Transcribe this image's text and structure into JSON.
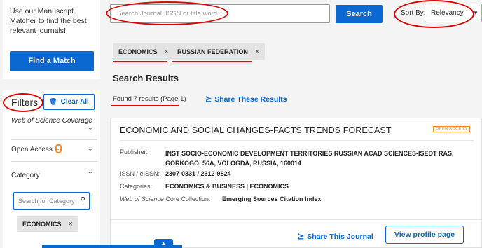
{
  "promo": {
    "text": "Use our Manuscript Matcher to find the best relevant journals!",
    "button": "Find a Match"
  },
  "filters": {
    "title": "Filters",
    "clear_label": "Clear All",
    "facets": [
      {
        "label": "Web of Science Coverage"
      },
      {
        "label": "Open Access"
      },
      {
        "label": "Category"
      }
    ],
    "category_search_placeholder": "Search for Category",
    "selected_chip": "ECONOMICS"
  },
  "search": {
    "placeholder": "Search Journal, ISSN or title word...",
    "button": "Search"
  },
  "sort": {
    "label": "Sort By:",
    "value": "Relevancy"
  },
  "active_filters": [
    "ECONOMICS",
    "RUSSIAN FEDERATION"
  ],
  "results": {
    "heading": "Search Results",
    "found_text": "Found 7 results (Page 1)",
    "share_label": "Share These Results"
  },
  "journal": {
    "title": "ECONOMIC AND SOCIAL CHANGES-FACTS TRENDS FORECAST",
    "oa_badge": "OPEN ACCESS",
    "publisher_label": "Publisher:",
    "publisher": "INST SOCIO-ECONOMIC DEVELOPMENT TERRITORIES RUSSIAN ACAD SCIENCES-ISEDT RAS, GORKOGO, 56A, VOLOGDA, RUSSIA, 160014",
    "issn_label": "ISSN / eISSN:",
    "issn": "2307-0331 / 2312-9824",
    "categories_label": "Categories:",
    "categories": "ECONOMICS & BUSINESS | ECONOMICS",
    "collection_label_italic": "Web of Science",
    "collection_label_rest": " Core Collection:",
    "collection": "Emerging Sources Citation Index",
    "share_label": "Share This Journal",
    "profile_button": "View profile page"
  },
  "colors": {
    "accent": "#0b68d0",
    "annotation": "#e00000",
    "open_access": "#f38b21"
  }
}
